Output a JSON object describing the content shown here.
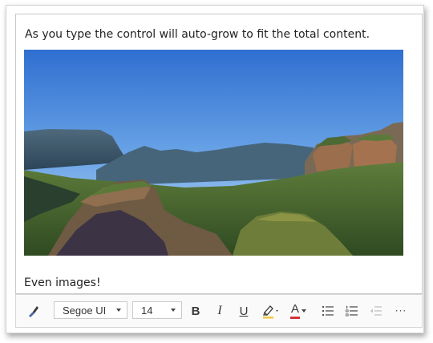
{
  "editor": {
    "intro_text": "As you type the control will auto-grow to fit the total content.",
    "caption_text": "Even images!"
  },
  "toolbar": {
    "font_family": "Segoe UI",
    "font_size": "14",
    "bold_label": "B",
    "italic_label": "I",
    "underline_label": "U",
    "font_color_label": "A",
    "more_label": "···",
    "icons": {
      "format_painter": "paintbrush-icon",
      "highlight": "highlighter-icon",
      "bullets": "bulleted-list-icon",
      "numbering": "numbered-list-icon",
      "outdent": "decrease-indent-icon",
      "more": "more-options-icon"
    },
    "colors": {
      "highlight_bar": "#f2c744",
      "font_color_bar": "#d13438"
    }
  }
}
